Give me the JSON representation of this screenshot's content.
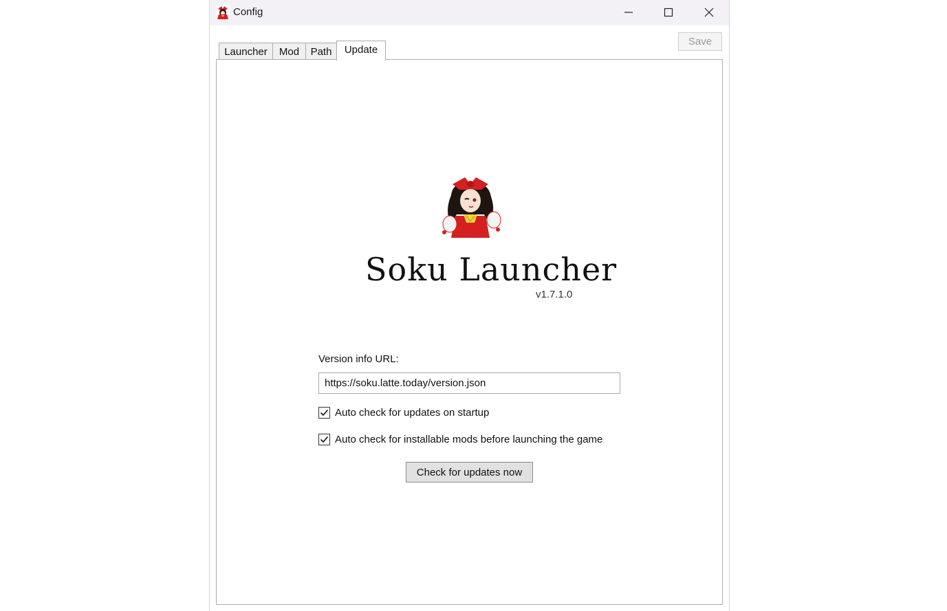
{
  "window": {
    "title": "Config",
    "icon": "reimu-app-icon",
    "controls": {
      "minimize_icon": "minimize-icon",
      "maximize_icon": "maximize-icon",
      "close_icon": "close-icon"
    }
  },
  "toolbar": {
    "save_label": "Save"
  },
  "tabs": [
    {
      "label": "Launcher",
      "active": false
    },
    {
      "label": "Mod",
      "active": false
    },
    {
      "label": "Path",
      "active": false
    },
    {
      "label": "Update",
      "active": true
    }
  ],
  "update_panel": {
    "logo_image": "reimu-portrait",
    "app_name": "Soku Launcher",
    "version": "v1.7.1.0",
    "version_url_label": "Version info URL:",
    "version_url_value": "https://soku.latte.today/version.json",
    "auto_check_updates": {
      "label": "Auto check for updates on startup",
      "checked": true
    },
    "auto_check_mods": {
      "label": "Auto check for installable mods before launching the game",
      "checked": true
    },
    "check_now_label": "Check for updates now"
  },
  "colors": {
    "titlebar_bg": "#f4f1f6",
    "tab_border": "#acacac",
    "button_bg": "#e1e1e1",
    "disabled_text": "#9c9c9c",
    "accent_red": "#d42020"
  }
}
